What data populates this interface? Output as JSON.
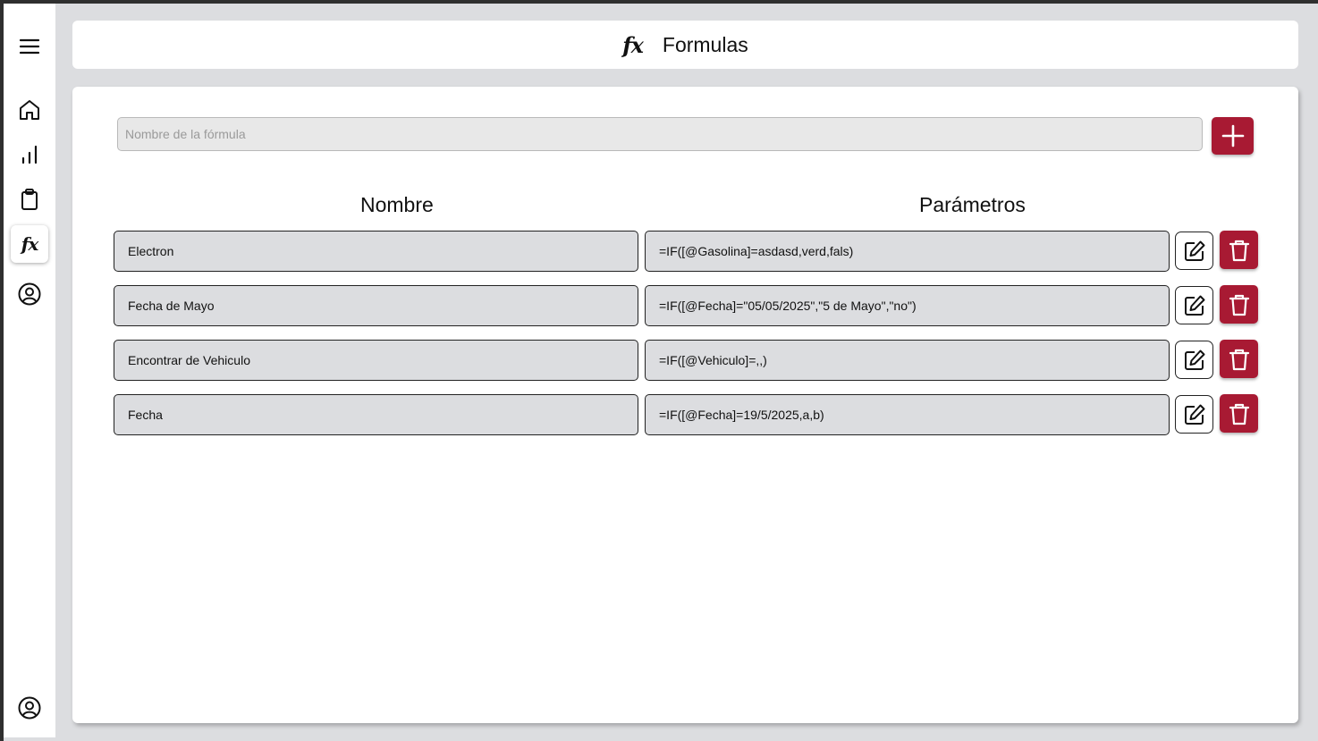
{
  "header": {
    "icon": "fx-icon",
    "title": "Formulas"
  },
  "sidebar": {
    "items": [
      {
        "icon": "menu-icon"
      },
      {
        "icon": "home-icon"
      },
      {
        "icon": "bar-chart-icon"
      },
      {
        "icon": "clipboard-icon"
      },
      {
        "icon": "fx-icon",
        "active": true,
        "glyph": "fx"
      },
      {
        "icon": "user-circle-icon"
      },
      {
        "icon": "account-icon"
      }
    ]
  },
  "form": {
    "name_placeholder": "Nombre de la fórmula",
    "add_icon": "plus-icon"
  },
  "table": {
    "headers": {
      "name": "Nombre",
      "params": "Parámetros"
    },
    "rows": [
      {
        "name": "Electron",
        "params": "=IF([@Gasolina]=asdasd,verd,fals)"
      },
      {
        "name": "Fecha de Mayo",
        "params": "=IF([@Fecha]=\"05/05/2025\",\"5 de Mayo\",\"no\")"
      },
      {
        "name": "Encontrar de Vehiculo",
        "params": "=IF([@Vehiculo]=,,)"
      },
      {
        "name": "Fecha",
        "params": "=IF([@Fecha]=19/5/2025,a,b)"
      }
    ]
  },
  "colors": {
    "accent": "#a81a33",
    "background": "#dcdde0",
    "surface": "#ffffff"
  }
}
